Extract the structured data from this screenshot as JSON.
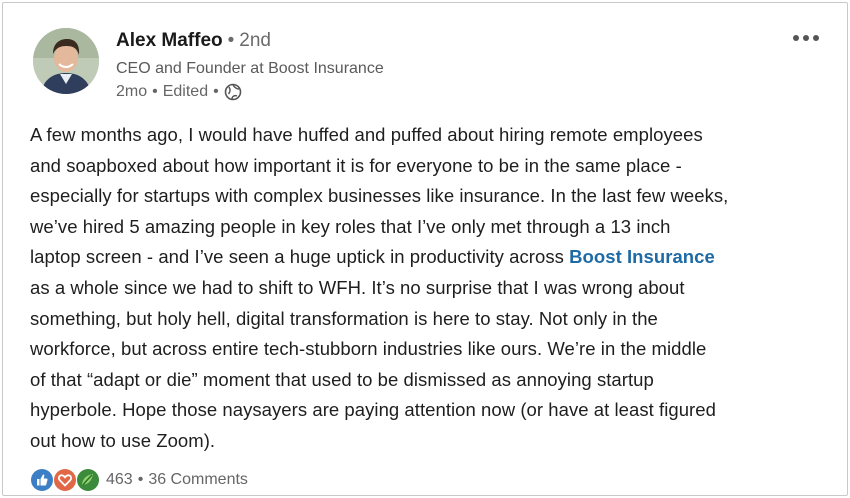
{
  "author": {
    "name": "Alex Maffeo",
    "degree": "2nd",
    "headline": "CEO and Founder at Boost Insurance",
    "time": "2mo",
    "edited": "Edited",
    "visibility_icon": "globe-icon"
  },
  "post": {
    "lines": [
      "A few months ago, I would have huffed and puffed about hiring remote employees",
      "and soapboxed about how important it is for everyone to be in the same place -",
      "especially for startups with complex businesses like insurance. In the last few weeks,",
      "we’ve hired 5 amazing people in key roles that I’ve only met through a 13 inch",
      "laptop screen - and I’ve seen a huge uptick in productivity across "
    ],
    "link": "Boost Insurance",
    "lines_after": [
      "as a whole since we had to shift to WFH. It’s no surprise that I was wrong about",
      "something, but holy hell, digital transformation is here to stay. Not only in the",
      "workforce, but across entire tech-stubborn industries like ours. We’re in the middle",
      "of that “adapt or die” moment that used to be dismissed as annoying startup",
      "hyperbole. Hope those naysayers are paying attention now (or have at least figured",
      "out how to use Zoom)."
    ]
  },
  "social": {
    "reaction_icons": [
      "like-icon",
      "love-icon",
      "insightful-icon"
    ],
    "reaction_count": "463",
    "comments": "36 Comments"
  },
  "colors": {
    "link": "#1d6aa5",
    "like": "#3d7fc5",
    "love": "#e06847",
    "insightful": "#3c8a3c"
  }
}
